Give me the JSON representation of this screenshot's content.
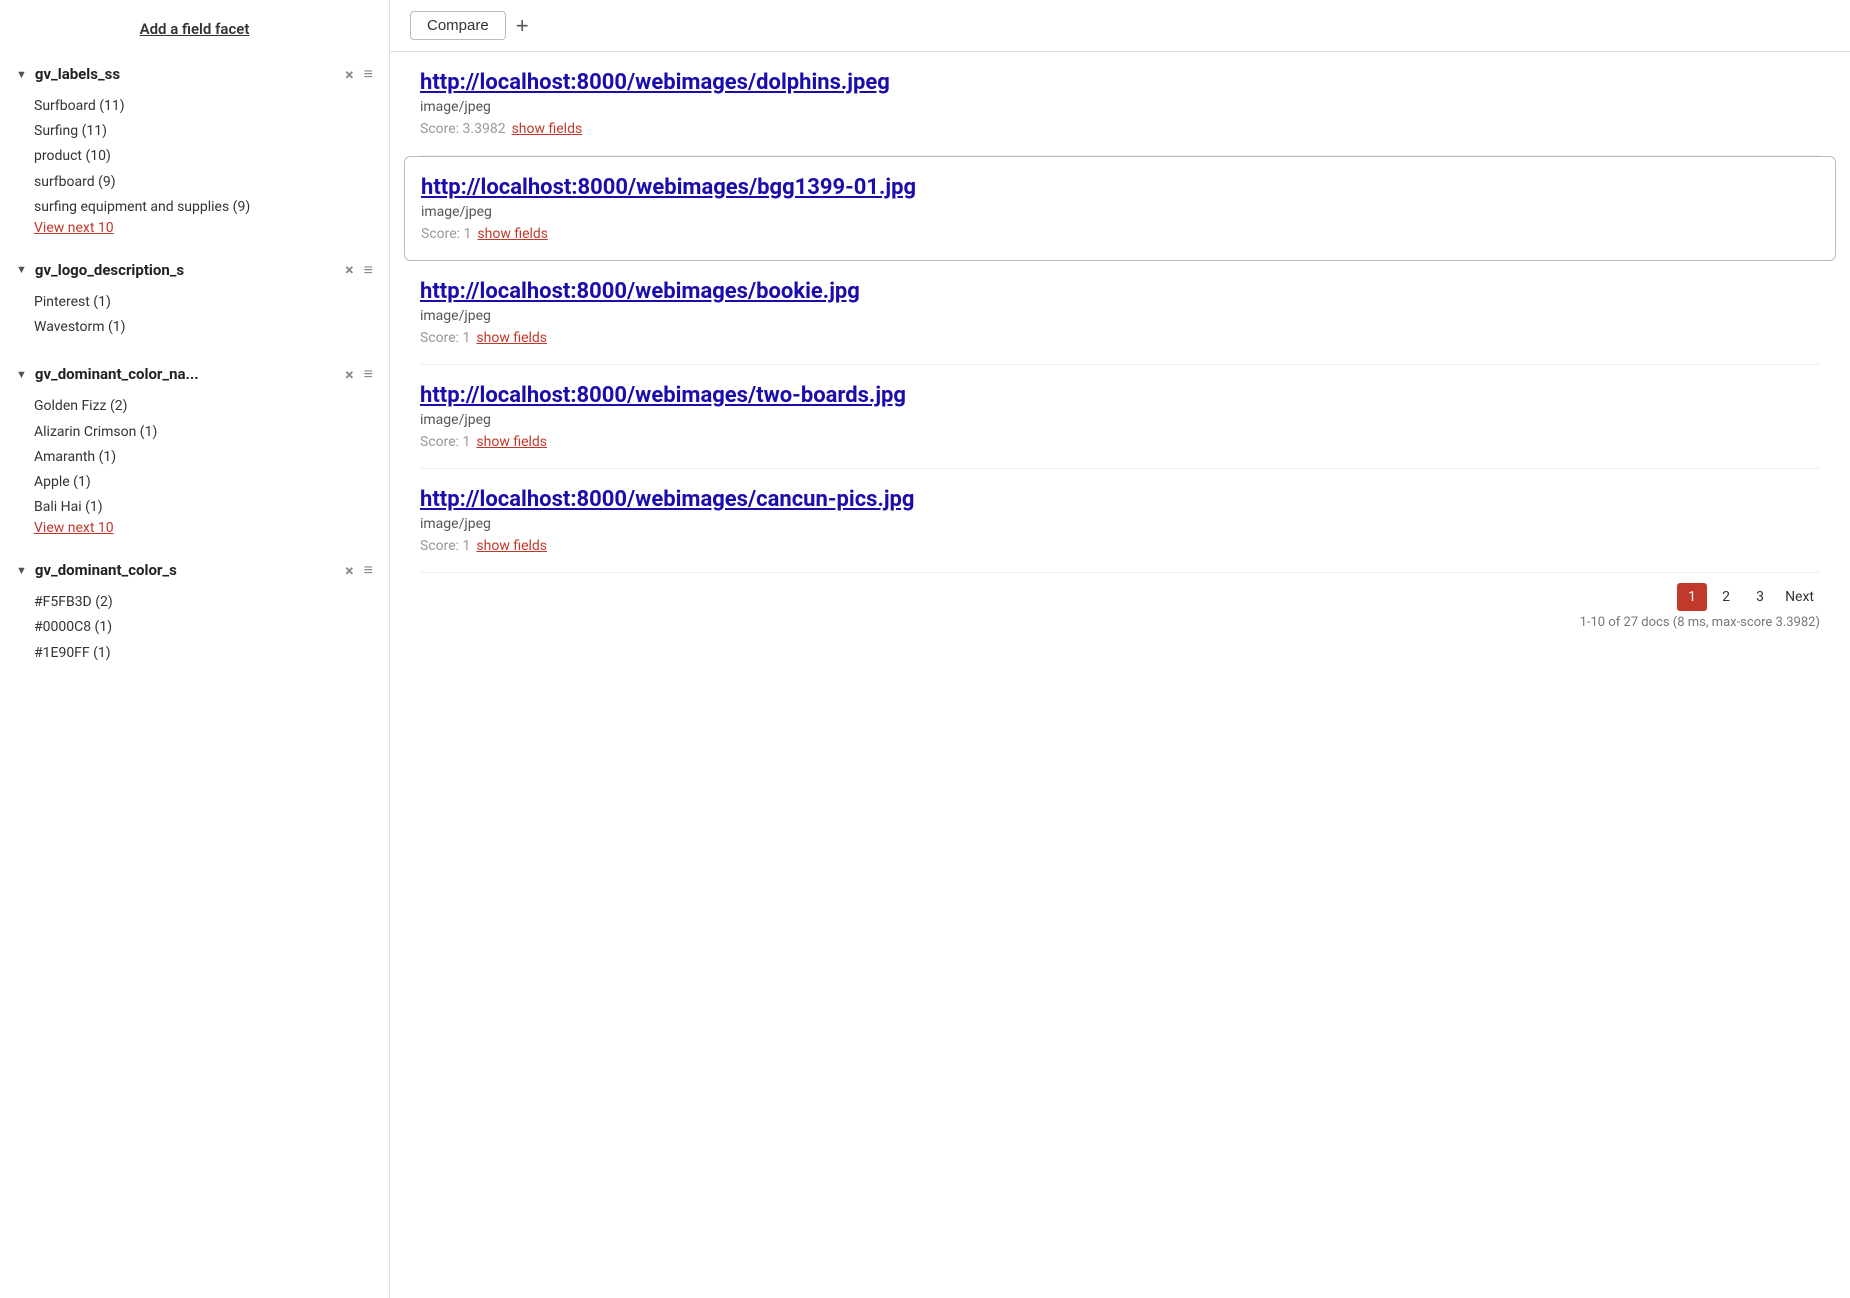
{
  "sidebar": {
    "add_facet_label": "Add a field facet",
    "facets": [
      {
        "id": "gv_labels_ss",
        "title": "gv_labels_ss",
        "expanded": true,
        "items": [
          "Surfboard (11)",
          "Surfing (11)",
          "product (10)",
          "surfboard (9)",
          "surfing equipment and supplies (9)"
        ],
        "view_next_label": "View next 10"
      },
      {
        "id": "gv_logo_description_s",
        "title": "gv_logo_description_s",
        "expanded": true,
        "items": [
          "Pinterest (1)",
          "Wavestorm (1)"
        ],
        "view_next_label": null
      },
      {
        "id": "gv_dominant_color_na",
        "title": "gv_dominant_color_na...",
        "expanded": true,
        "items": [
          "Golden Fizz (2)",
          "Alizarin Crimson (1)",
          "Amaranth (1)",
          "Apple (1)",
          "Bali Hai (1)"
        ],
        "view_next_label": "View next 10"
      },
      {
        "id": "gv_dominant_color_s",
        "title": "gv_dominant_color_s",
        "expanded": true,
        "items": [
          "#F5FB3D (2)",
          "#0000C8 (1)",
          "#1E90FF (1)"
        ],
        "view_next_label": null
      }
    ]
  },
  "topbar": {
    "compare_label": "Compare",
    "add_tab_label": "+"
  },
  "results": [
    {
      "id": "result-1",
      "url": "http://localhost:8000/webimages/dolphins.jpeg",
      "type": "image/jpeg",
      "score": "3.3982",
      "show_fields_label": "show fields",
      "highlighted": false
    },
    {
      "id": "result-2",
      "url": "http://localhost:8000/webimages/bgg1399-01.jpg",
      "type": "image/jpeg",
      "score": "1",
      "show_fields_label": "show fields",
      "highlighted": true
    },
    {
      "id": "result-3",
      "url": "http://localhost:8000/webimages/bookie.jpg",
      "type": "image/jpeg",
      "score": "1",
      "show_fields_label": "show fields",
      "highlighted": false
    },
    {
      "id": "result-4",
      "url": "http://localhost:8000/webimages/two-boards.jpg",
      "type": "image/jpeg",
      "score": "1",
      "show_fields_label": "show fields",
      "highlighted": false
    },
    {
      "id": "result-5",
      "url": "http://localhost:8000/webimages/cancun-pics.jpg",
      "type": "image/jpeg",
      "score": "1",
      "show_fields_label": "show fields",
      "highlighted": false
    }
  ],
  "pagination": {
    "pages": [
      "1",
      "2",
      "3"
    ],
    "active_page": "1",
    "next_label": "Next"
  },
  "docs_info": "1-10 of 27 docs (8 ms, max-score 3.3982)",
  "score_prefix": "Score:",
  "icons": {
    "chevron_down": "▼",
    "close": "×",
    "hamburger": "≡"
  }
}
